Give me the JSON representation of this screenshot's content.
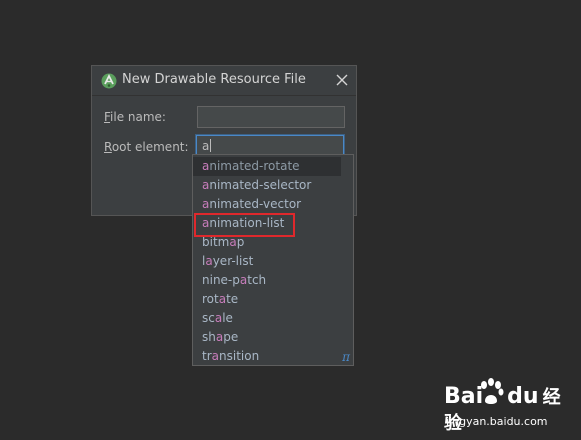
{
  "dialog": {
    "title": "New Drawable Resource File",
    "file_name": {
      "mnemonic": "F",
      "label_rest": "ile name:",
      "value": ""
    },
    "root_element": {
      "mnemonic": "R",
      "label_rest": "oot element:",
      "value": "a"
    }
  },
  "autocomplete": {
    "typed_prefix": "a",
    "items": [
      {
        "match": "a",
        "rest": "nimated-rotate"
      },
      {
        "match": "a",
        "rest": "nimated-selector"
      },
      {
        "match": "a",
        "rest": "nimated-vector"
      },
      {
        "match": "a",
        "rest": "nimation-list"
      },
      {
        "match": "",
        "rest": "bitm",
        "match2": "a",
        "rest2": "p"
      },
      {
        "match": "",
        "rest": "l",
        "match2": "a",
        "rest2": "yer-list"
      },
      {
        "match": "",
        "rest": "nine-p",
        "match2": "a",
        "rest2": "tch"
      },
      {
        "match": "",
        "rest": "rot",
        "match2": "a",
        "rest2": "te"
      },
      {
        "match": "",
        "rest": "sc",
        "match2": "a",
        "rest2": "le"
      },
      {
        "match": "",
        "rest": "sh",
        "match2": "a",
        "rest2": "pe"
      },
      {
        "match": "",
        "rest": "tr",
        "match2": "a",
        "rest2": "nsition"
      }
    ],
    "selected_index": 0,
    "highlighted_item": "animation-list",
    "footer_icon": "π"
  },
  "watermark": {
    "logo_left": "Bai",
    "logo_right": "经验",
    "logo_du": "du",
    "url": "jingyan.baidu.com"
  },
  "colors": {
    "background": "#2b2b2b",
    "dialog": "#3c3f41",
    "text": "#bbbbbb",
    "match_highlight": "#c77dbb",
    "focus_border": "#4a88c7",
    "annotation_box": "#e0282c"
  },
  "icons": {
    "app": "android-studio-icon",
    "close": "close-icon",
    "popup_footer": "pi-icon"
  }
}
